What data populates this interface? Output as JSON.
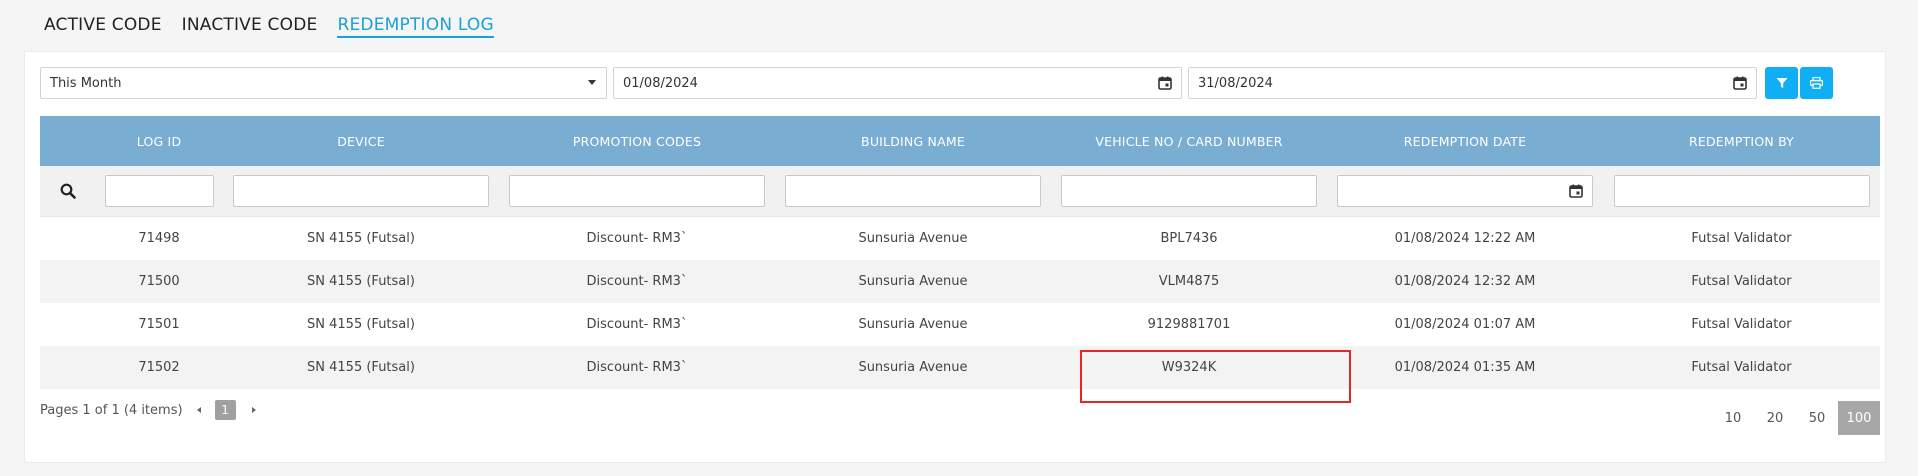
{
  "tabs": [
    {
      "label": "ACTIVE CODE"
    },
    {
      "label": "INACTIVE CODE"
    },
    {
      "label": "REDEMPTION LOG"
    }
  ],
  "filters": {
    "period": "This Month",
    "date_from": "01/08/2024",
    "date_to": "31/08/2024"
  },
  "icons": {
    "filter_button": "filter-icon",
    "print_button": "print-icon",
    "search": "search-icon",
    "calendar": "calendar-icon"
  },
  "colors": {
    "accent": "#1ba0d8",
    "button": "#10aff5",
    "header": "#79aed2",
    "highlight": "#e3262a"
  },
  "grid": {
    "columns": [
      "LOG ID",
      "DEVICE",
      "PROMOTION CODES",
      "BUILDING NAME",
      "VEHICLE NO / CARD NUMBER",
      "REDEMPTION DATE",
      "REDEMPTION BY"
    ],
    "rows": [
      [
        "71498",
        "SN 4155 (Futsal)",
        "Discount- RM3`",
        "Sunsuria Avenue",
        "BPL7436",
        "01/08/2024 12:22 AM",
        "Futsal Validator"
      ],
      [
        "71500",
        "SN 4155 (Futsal)",
        "Discount- RM3`",
        "Sunsuria Avenue",
        "VLM4875",
        "01/08/2024 12:32 AM",
        "Futsal Validator"
      ],
      [
        "71501",
        "SN 4155 (Futsal)",
        "Discount- RM3`",
        "Sunsuria Avenue",
        "9129881701",
        "01/08/2024 01:07 AM",
        "Futsal Validator"
      ],
      [
        "71502",
        "SN 4155 (Futsal)",
        "Discount- RM3`",
        "Sunsuria Avenue",
        "W9324K",
        "01/08/2024 01:35 AM",
        "Futsal Validator"
      ]
    ]
  },
  "pager": {
    "summary": "Pages 1 of 1 (4 items)",
    "current_page": "1",
    "page_sizes": [
      "10",
      "20",
      "50",
      "100"
    ],
    "selected_size": "100"
  }
}
